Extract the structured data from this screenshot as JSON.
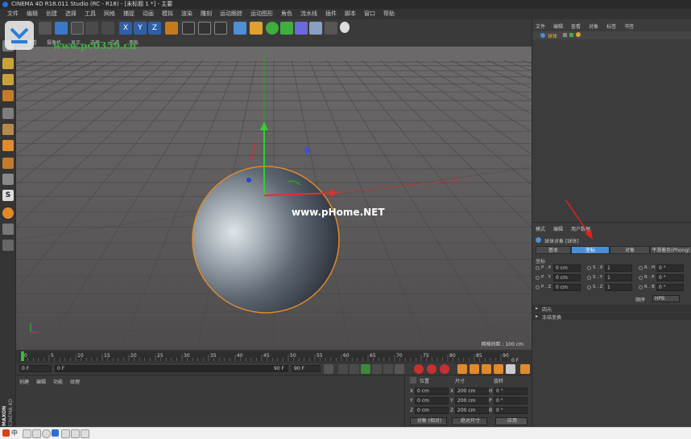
{
  "window": {
    "title": "CINEMA 4D R18.011 Studio (RC - R18) - [未标题 1 *] - 主要"
  },
  "menu": [
    "文件",
    "编辑",
    "创建",
    "选择",
    "工具",
    "网格",
    "捕捉",
    "动画",
    "模拟",
    "渲染",
    "雕刻",
    "运动跟踪",
    "运动图形",
    "角色",
    "流水线",
    "插件",
    "脚本",
    "窗口",
    "帮助"
  ],
  "viewport": {
    "menu": [
      "查看",
      "摄像机",
      "显示",
      "选项",
      "过滤",
      "面板"
    ],
    "grid_label": "网格间距 : 100 cm",
    "watermark_top": "www.pc0359.cn",
    "watermark_center": "www.pHome.NET"
  },
  "timeline": {
    "ticks": [
      "0",
      "5",
      "10",
      "15",
      "20",
      "25",
      "30",
      "35",
      "40",
      "45",
      "50",
      "55",
      "60",
      "65",
      "70",
      "75",
      "80",
      "85",
      "90"
    ],
    "end_label": "0 F"
  },
  "playback": {
    "current_frame": "0 F",
    "start_frame": "0 F",
    "end_frame": "90 F",
    "max_frame": "90 F"
  },
  "material_manager": {
    "menu": [
      "创建",
      "编辑",
      "功能",
      "纹理"
    ]
  },
  "coordinates": {
    "headers": {
      "position": "位置",
      "size": "尺寸",
      "rotation": "旋转"
    },
    "rows": [
      {
        "axis": "X",
        "pos": "0 cm",
        "size_axis": "X",
        "size": "200 cm",
        "rot_axis": "H",
        "rot": "0 °"
      },
      {
        "axis": "Y",
        "pos": "0 cm",
        "size_axis": "Y",
        "size": "200 cm",
        "rot_axis": "P",
        "rot": "0 °"
      },
      {
        "axis": "Z",
        "pos": "0 cm",
        "size_axis": "Z",
        "size": "200 cm",
        "rot_axis": "B",
        "rot": "0 °"
      }
    ],
    "mode_select": "对象 (相对)",
    "size_select": "绝对尺寸",
    "apply_button": "应用"
  },
  "object_manager": {
    "menu": [
      "文件",
      "编辑",
      "查看",
      "对象",
      "标签",
      "书签"
    ],
    "objects": [
      {
        "name": "球体"
      }
    ]
  },
  "attribute_manager": {
    "menu": [
      "模式",
      "编辑",
      "用户数据"
    ],
    "object_title": "球体对象 [球体]",
    "tabs": [
      "基本",
      "坐标",
      "对象",
      "平滑着色(Phong)"
    ],
    "active_tab": "坐标",
    "section_title": "坐标",
    "fields": [
      {
        "p_label": "P . X",
        "p_val": "0 cm",
        "s_label": "S . X",
        "s_val": "1",
        "r_label": "R . H",
        "r_val": "0 °"
      },
      {
        "p_label": "P . Y",
        "p_val": "0 cm",
        "s_label": "S . Y",
        "s_val": "1",
        "r_label": "R . P",
        "r_val": "0 °"
      },
      {
        "p_label": "P . Z",
        "p_val": "0 cm",
        "s_label": "S . Z",
        "s_val": "1",
        "r_label": "R . B",
        "r_val": "0 °"
      }
    ],
    "order_label": "顺序",
    "order_value": "HPB",
    "collapsed_sections": [
      "四元",
      "冻结变换"
    ]
  },
  "brand": {
    "maxon": "MAXON",
    "c4d": "CINEMA 4D"
  },
  "taskbar": {
    "ime": "中"
  },
  "colors": {
    "accent_blue": "#4a8fd6",
    "orange": "#e08a2c",
    "axis_red": "#e03030",
    "axis_green": "#30c030"
  }
}
